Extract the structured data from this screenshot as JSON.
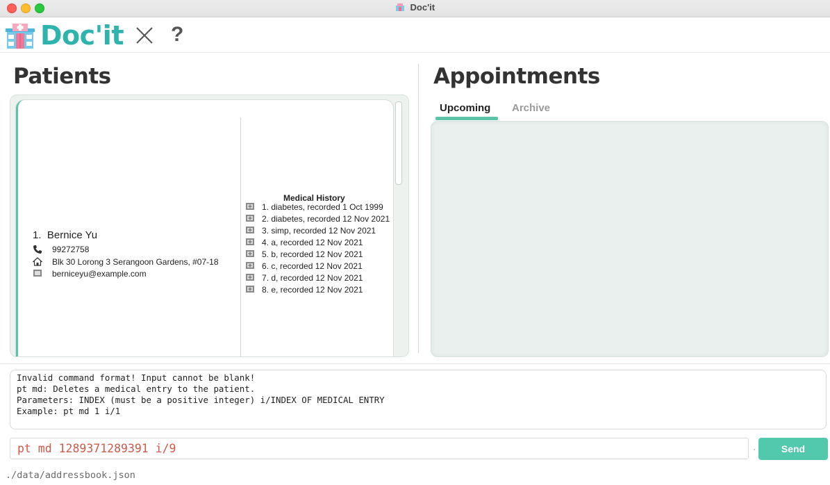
{
  "window": {
    "title": "Doc'it"
  },
  "toolbar": {
    "app_name": "Doc'it",
    "help_label": "?"
  },
  "patients": {
    "heading": "Patients",
    "list": [
      {
        "index": "1.",
        "name": "Bernice Yu",
        "phone": "99272758",
        "address": "Blk 30 Lorong 3 Serangoon Gardens, #07-18",
        "email": "berniceyu@example.com",
        "medical_history_title": "Medical History",
        "medical_history": [
          "1. diabetes, recorded 1 Oct 1999",
          "2. diabetes, recorded 12 Nov 2021",
          "3. simp, recorded 12 Nov 2021",
          "4. a, recorded 12 Nov 2021",
          "5. b, recorded 12 Nov 2021",
          "6. c, recorded 12 Nov 2021",
          "7. d, recorded 12 Nov 2021",
          "8. e, recorded 12 Nov 2021"
        ]
      }
    ]
  },
  "appointments": {
    "heading": "Appointments",
    "tabs": [
      {
        "label": "Upcoming",
        "selected": true
      },
      {
        "label": "Archive",
        "selected": false
      }
    ]
  },
  "result": {
    "lines": [
      "Invalid command format! Input cannot be blank!",
      "pt md: Deletes a medical entry to the patient.",
      "Parameters: INDEX (must be a positive integer) i/INDEX OF MEDICAL ENTRY",
      "Example: pt md 1 i/1"
    ]
  },
  "command": {
    "value": "pt md 1289371289391 i/9",
    "send_label": "Send"
  },
  "status": {
    "file_path": "./data/addressbook.json"
  },
  "colors": {
    "accent": "#5cc3a6",
    "brand": "#2fb3ad",
    "command_text": "#d0594a",
    "send_button": "#52c8ac"
  }
}
